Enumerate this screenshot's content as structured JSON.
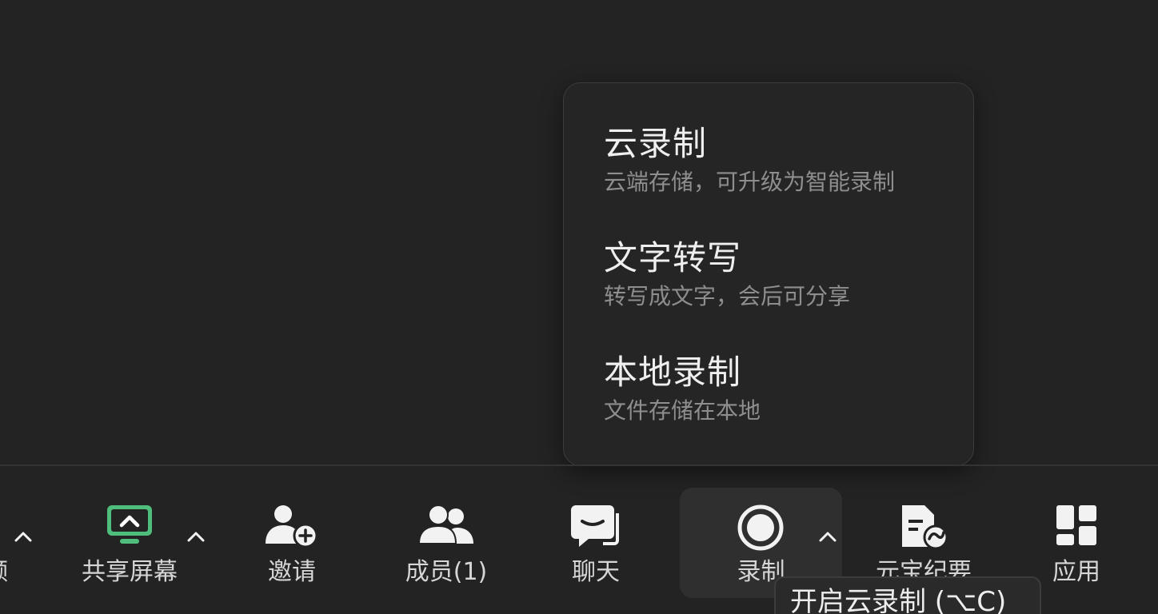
{
  "record_menu": {
    "items": [
      {
        "title": "云录制",
        "description": "云端存储，可升级为智能录制"
      },
      {
        "title": "文字转写",
        "description": "转写成文字，会后可分享"
      },
      {
        "title": "本地录制",
        "description": "文件存储在本地"
      }
    ]
  },
  "toolbar": {
    "video_label": "频",
    "share_label": "共享屏幕",
    "invite_label": "邀请",
    "members_label": "成员(1)",
    "chat_label": "聊天",
    "record_label": "录制",
    "ai_minutes_label": "元宝纪要",
    "apps_label": "应用"
  },
  "tooltip": {
    "text": "开启云录制 (⌥C)"
  },
  "colors": {
    "background": "#232323",
    "share_icon": "#4fbe7c",
    "menu_title": "#efefef",
    "menu_desc": "#8e8e8e",
    "icon": "#f2f2f2"
  },
  "icons": {
    "share": "monitor-share-icon",
    "invite": "add-user-icon",
    "members": "users-icon",
    "chat": "chat-bubble-icon",
    "record": "record-circle-icon",
    "ai_minutes": "document-ai-icon",
    "apps": "grid-apps-icon",
    "caret": "chevron-up-icon"
  }
}
